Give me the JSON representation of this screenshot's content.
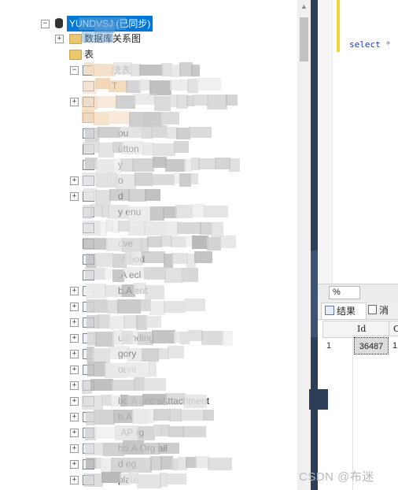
{
  "explorer": {
    "database_label": "YUNDVSJ (已同步)",
    "diagrams_label": "数据库关系图",
    "tables_label": "表",
    "table_items": [
      {
        "label": "统表",
        "expand": "minus"
      },
      {
        "label": "T",
        "expand": "none"
      },
      {
        "label": "",
        "expand": "plus"
      },
      {
        "label": "",
        "expand": "none"
      },
      {
        "label": "ou",
        "expand": "none"
      },
      {
        "label": "utton",
        "expand": "none"
      },
      {
        "label": "y",
        "expand": "none"
      },
      {
        "label": "o",
        "expand": "plus"
      },
      {
        "label": "d",
        "expand": "plus"
      },
      {
        "label": "y enu",
        "expand": "none"
      },
      {
        "label": "",
        "expand": "none"
      },
      {
        "label": "ove",
        "expand": "none"
      },
      {
        "label": ".A hod",
        "expand": "none"
      },
      {
        "label": ".A ecl",
        "expand": "none"
      },
      {
        "label": "b.A ent",
        "expand": "plus"
      },
      {
        "label": "",
        "expand": "plus"
      },
      {
        "label": "",
        "expand": "plus"
      },
      {
        "label": "un nding",
        "expand": "plus"
      },
      {
        "label": "gory",
        "expand": "plus"
      },
      {
        "label": "ount",
        "expand": "plus"
      },
      {
        "label": "",
        "expand": "plus"
      },
      {
        "label": "bo.A ecc sAttachment",
        "expand": "plus"
      },
      {
        "label": "b.A",
        "expand": "plus"
      },
      {
        "label": ".AP rg",
        "expand": "plus"
      },
      {
        "label": "bo.A Org ail",
        "expand": "plus"
      },
      {
        "label": "d og",
        "expand": "plus"
      },
      {
        "label": "plate",
        "expand": "plus"
      }
    ]
  },
  "editor": {
    "code_keyword": "select",
    "code_rest": "*"
  },
  "results": {
    "zoom": "%",
    "tab_results": "结果",
    "tab_messages": "消",
    "columns": [
      "Id",
      "C"
    ],
    "rows": [
      {
        "rownum": "1",
        "id": "36487",
        "c": "1"
      }
    ]
  },
  "watermark": "CSDN @布迷"
}
